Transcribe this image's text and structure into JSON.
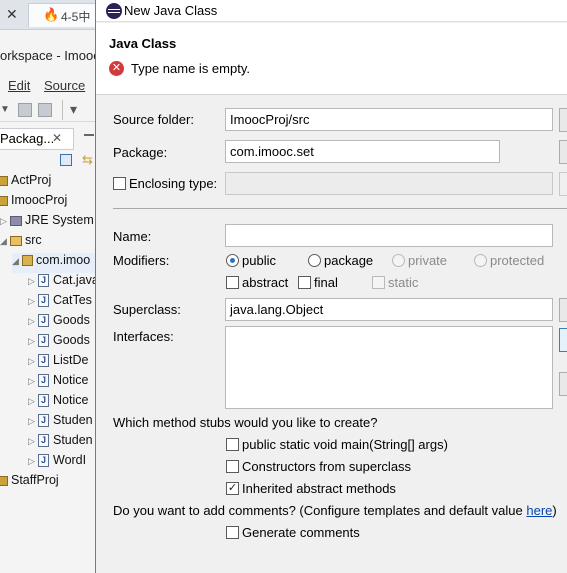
{
  "background": {
    "tab_title": "4-5中",
    "workspace_title": "orkspace - Imooc",
    "menu": [
      "Edit",
      "Source"
    ],
    "view_tab": "Packag...",
    "tree": [
      {
        "label": "ActProj",
        "kind": "project"
      },
      {
        "label": "ImoocProj",
        "kind": "project"
      },
      {
        "label": "JRE System",
        "kind": "library"
      },
      {
        "label": "src",
        "kind": "folder"
      },
      {
        "label": "com.imoo",
        "kind": "package"
      },
      {
        "label": "Cat.java",
        "kind": "file"
      },
      {
        "label": "CatTes",
        "kind": "file"
      },
      {
        "label": "Goods",
        "kind": "file"
      },
      {
        "label": "Goods",
        "kind": "file"
      },
      {
        "label": "ListDe",
        "kind": "file"
      },
      {
        "label": "Notice",
        "kind": "file"
      },
      {
        "label": "Notice",
        "kind": "file"
      },
      {
        "label": "Studen",
        "kind": "file"
      },
      {
        "label": "Studen",
        "kind": "file"
      },
      {
        "label": "WordI",
        "kind": "file"
      },
      {
        "label": "StaffProj",
        "kind": "project"
      }
    ]
  },
  "dialog": {
    "window_title": "New Java Class",
    "header_title": "Java Class",
    "error_message": "Type name is empty.",
    "source_folder": {
      "label": "Source folder:",
      "value": "ImoocProj/src"
    },
    "package": {
      "label": "Package:",
      "value": "com.imooc.set"
    },
    "enclosing_type": {
      "label": "Enclosing type:",
      "value": "",
      "checked": false
    },
    "name": {
      "label": "Name:",
      "value": ""
    },
    "modifiers": {
      "label": "Modifiers:",
      "access": [
        "public",
        "package",
        "private",
        "protected"
      ],
      "selected": "public",
      "options": [
        "abstract",
        "final",
        "static"
      ]
    },
    "superclass": {
      "label": "Superclass:",
      "value": "java.lang.Object"
    },
    "interfaces": {
      "label": "Interfaces:"
    },
    "stubs_question": "Which method stubs would you like to create?",
    "stubs": [
      {
        "label": "public static void main(String[] args)",
        "checked": false
      },
      {
        "label": "Constructors from superclass",
        "checked": false
      },
      {
        "label": "Inherited abstract methods",
        "checked": true
      }
    ],
    "comments_question": "Do you want to add comments? (Configure templates and default value ",
    "comments_link": "here",
    "comments_close": ")",
    "generate_comments": {
      "label": "Generate comments",
      "checked": false
    }
  }
}
